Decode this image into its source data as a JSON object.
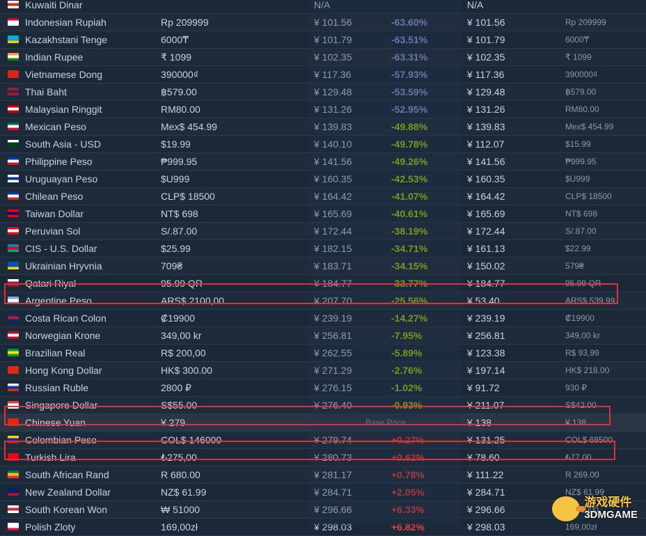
{
  "rows": [
    {
      "flag": [
        "#ffffff",
        "#d52b1e",
        "#ffffff"
      ],
      "name": "Kuwaiti Dinar",
      "price": "",
      "cny": "N/A",
      "diff": "",
      "sale": "N/A",
      "orig": "",
      "cls": "neg-big"
    },
    {
      "flag": [
        "#ce1126",
        "#ffffff",
        "#ffffff"
      ],
      "name": "Indonesian Rupiah",
      "price": "Rp 209999",
      "cny": "¥ 101.56",
      "diff": "-63.60%",
      "sale": "¥ 101.56",
      "orig": "Rp 209999",
      "cls": "neg-big"
    },
    {
      "flag": [
        "#00afca",
        "#00afca",
        "#fec50c"
      ],
      "name": "Kazakhstani Tenge",
      "price": "6000₸",
      "cny": "¥ 101.79",
      "diff": "-63.51%",
      "sale": "¥ 101.79",
      "orig": "6000₸",
      "cls": "neg-big"
    },
    {
      "flag": [
        "#ff9933",
        "#ffffff",
        "#138808"
      ],
      "name": "Indian Rupee",
      "price": "₹ 1099",
      "cny": "¥ 102.35",
      "diff": "-63.31%",
      "sale": "¥ 102.35",
      "orig": "₹ 1099",
      "cls": "neg-big"
    },
    {
      "flag": [
        "#da251d",
        "#da251d",
        "#da251d"
      ],
      "name": "Vietnamese Dong",
      "price": "390000₫",
      "cny": "¥ 117.36",
      "diff": "-57.93%",
      "sale": "¥ 117.36",
      "orig": "390000₫",
      "cls": "neg-big"
    },
    {
      "flag": [
        "#a51931",
        "#2d2a4a",
        "#a51931"
      ],
      "name": "Thai Baht",
      "price": "฿579.00",
      "cny": "¥ 129.48",
      "diff": "-53.59%",
      "sale": "¥ 129.48",
      "orig": "฿579.00",
      "cls": "neg-big"
    },
    {
      "flag": [
        "#cc0001",
        "#ffffff",
        "#cc0001"
      ],
      "name": "Malaysian Ringgit",
      "price": "RM80.00",
      "cny": "¥ 131.26",
      "diff": "-52.95%",
      "sale": "¥ 131.26",
      "orig": "RM80.00",
      "cls": "neg-big"
    },
    {
      "flag": [
        "#006847",
        "#ffffff",
        "#ce1126"
      ],
      "name": "Mexican Peso",
      "price": "Mex$ 454.99",
      "cny": "¥ 139.83",
      "diff": "-49.88%",
      "sale": "¥ 139.83",
      "orig": "Mex$ 454.99",
      "cls": "neg"
    },
    {
      "flag": [
        "#ffffff",
        "#01411c",
        "#01411c"
      ],
      "name": "South Asia - USD",
      "price": "$19.99",
      "cny": "¥ 140.10",
      "diff": "-49.78%",
      "sale": "¥ 112.07",
      "orig": "$15.99",
      "cls": "neg"
    },
    {
      "flag": [
        "#0038a8",
        "#ffffff",
        "#ce1126"
      ],
      "name": "Philippine Peso",
      "price": "₱999.95",
      "cny": "¥ 141.56",
      "diff": "-49.26%",
      "sale": "¥ 141.56",
      "orig": "₱999.95",
      "cls": "neg"
    },
    {
      "flag": [
        "#ffffff",
        "#0038a8",
        "#ffffff"
      ],
      "name": "Uruguayan Peso",
      "price": "$U999",
      "cny": "¥ 160.35",
      "diff": "-42.53%",
      "sale": "¥ 160.35",
      "orig": "$U999",
      "cls": "neg"
    },
    {
      "flag": [
        "#0039a6",
        "#ffffff",
        "#d52b1e"
      ],
      "name": "Chilean Peso",
      "price": "CLP$ 18500",
      "cny": "¥ 164.42",
      "diff": "-41.07%",
      "sale": "¥ 164.42",
      "orig": "CLP$ 18500",
      "cls": "neg"
    },
    {
      "flag": [
        "#fe0000",
        "#000095",
        "#fe0000"
      ],
      "name": "Taiwan Dollar",
      "price": "NT$ 698",
      "cny": "¥ 165.69",
      "diff": "-40.61%",
      "sale": "¥ 165.69",
      "orig": "NT$ 698",
      "cls": "neg"
    },
    {
      "flag": [
        "#d91023",
        "#ffffff",
        "#d91023"
      ],
      "name": "Peruvian Sol",
      "price": "S/.87.00",
      "cny": "¥ 172.44",
      "diff": "-38.19%",
      "sale": "¥ 172.44",
      "orig": "S/.87.00",
      "cls": "neg"
    },
    {
      "flag": [
        "#0092bc",
        "#e4002b",
        "#00af66"
      ],
      "name": "CIS - U.S. Dollar",
      "price": "$25.99",
      "cny": "¥ 182.15",
      "diff": "-34.71%",
      "sale": "¥ 161.13",
      "orig": "$22.99",
      "cls": "neg"
    },
    {
      "flag": [
        "#0057b7",
        "#0057b7",
        "#ffd700"
      ],
      "name": "Ukrainian Hryvnia",
      "price": "709₴",
      "cny": "¥ 183.71",
      "diff": "-34.15%",
      "sale": "¥ 150.02",
      "orig": "579₴",
      "cls": "neg"
    },
    {
      "flag": [
        "#ffffff",
        "#8d1b3d",
        "#8d1b3d"
      ],
      "name": "Qatari Riyal",
      "price": "95.99 QR",
      "cny": "¥ 184.77",
      "diff": "-33.77%",
      "sale": "¥ 184.77",
      "orig": "95.99 QR",
      "cls": "neg"
    },
    {
      "flag": [
        "#74acdf",
        "#ffffff",
        "#74acdf"
      ],
      "name": "Argentine Peso",
      "price": "ARS$ 2100,00",
      "cny": "¥ 207.70",
      "diff": "-25.56%",
      "sale": "¥ 53.40",
      "orig": "ARS$ 539,99",
      "cls": "neg"
    },
    {
      "flag": [
        "#002b7f",
        "#ce1126",
        "#002b7f"
      ],
      "name": "Costa Rican Colon",
      "price": "₡19900",
      "cny": "¥ 239.19",
      "diff": "-14.27%",
      "sale": "¥ 239.19",
      "orig": "₡19900",
      "cls": "neg"
    },
    {
      "flag": [
        "#ba0c2f",
        "#ffffff",
        "#ba0c2f"
      ],
      "name": "Norwegian Krone",
      "price": "349,00 kr",
      "cny": "¥ 256.81",
      "diff": "-7.95%",
      "sale": "¥ 256.81",
      "orig": "349,00 kr",
      "cls": "neg"
    },
    {
      "flag": [
        "#009c3b",
        "#ffdf00",
        "#009c3b"
      ],
      "name": "Brazilian Real",
      "price": "R$ 200,00",
      "cny": "¥ 262.55",
      "diff": "-5.89%",
      "sale": "¥ 123.38",
      "orig": "R$ 93,99",
      "cls": "neg"
    },
    {
      "flag": [
        "#de2910",
        "#de2910",
        "#de2910"
      ],
      "name": "Hong Kong Dollar",
      "price": "HK$ 300.00",
      "cny": "¥ 271.29",
      "diff": "-2.76%",
      "sale": "¥ 197.14",
      "orig": "HK$ 218.00",
      "cls": "neg"
    },
    {
      "flag": [
        "#ffffff",
        "#0039a6",
        "#d52b1e"
      ],
      "name": "Russian Ruble",
      "price": "2800 ₽",
      "cny": "¥ 276.15",
      "diff": "-1.02%",
      "sale": "¥ 91.72",
      "orig": "930 ₽",
      "cls": "neg"
    },
    {
      "flag": [
        "#ef3340",
        "#ffffff",
        "#ffffff"
      ],
      "name": "Singapore Dollar",
      "price": "S$55.00",
      "cny": "¥ 276.40",
      "diff": "-0.93%",
      "sale": "¥ 211.07",
      "orig": "S$42.00",
      "cls": "neg"
    },
    {
      "flag": [
        "#de2910",
        "#de2910",
        "#de2910"
      ],
      "name": "Chinese Yuan",
      "price": "¥ 279",
      "cny": "",
      "diff": "",
      "sale": "¥ 138",
      "orig": "¥ 138",
      "cls": "",
      "base": "Base Price"
    },
    {
      "flag": [
        "#fcd116",
        "#003893",
        "#ce1126"
      ],
      "name": "Colombian Peso",
      "price": "COL$ 146000",
      "cny": "¥ 279.74",
      "diff": "+0.27%",
      "sale": "¥ 131.25",
      "orig": "COL$ 68500",
      "cls": "pos"
    },
    {
      "flag": [
        "#e30a17",
        "#e30a17",
        "#e30a17"
      ],
      "name": "Turkish Lira",
      "price": "₺275,00",
      "cny": "¥ 280.73",
      "diff": "+0.62%",
      "sale": "¥ 78.60",
      "orig": "₺77,00",
      "cls": "pos"
    },
    {
      "flag": [
        "#007a4d",
        "#ffb612",
        "#de3831"
      ],
      "name": "South African Rand",
      "price": "R 680.00",
      "cny": "¥ 281.17",
      "diff": "+0.78%",
      "sale": "¥ 111.22",
      "orig": "R 269.00",
      "cls": "pos"
    },
    {
      "flag": [
        "#012169",
        "#012169",
        "#c8102e"
      ],
      "name": "New Zealand Dollar",
      "price": "NZ$ 61.99",
      "cny": "¥ 284.71",
      "diff": "+2.05%",
      "sale": "¥ 284.71",
      "orig": "NZ$ 61.99",
      "cls": "pos"
    },
    {
      "flag": [
        "#ffffff",
        "#cd2e3a",
        "#ffffff"
      ],
      "name": "South Korean Won",
      "price": "₩ 51000",
      "cny": "¥ 296.66",
      "diff": "+6.33%",
      "sale": "¥ 296.66",
      "orig": "₩ 51000",
      "cls": "pos"
    },
    {
      "flag": [
        "#ffffff",
        "#ffffff",
        "#dc143c"
      ],
      "name": "Polish Zloty",
      "price": "169,00zł",
      "cny": "¥ 298.03",
      "diff": "+6.82%",
      "sale": "¥ 298.03",
      "orig": "169,00zł",
      "cls": "pos"
    }
  ],
  "watermark": {
    "top": "游戏硬件",
    "bottom": "3DMGAME"
  }
}
